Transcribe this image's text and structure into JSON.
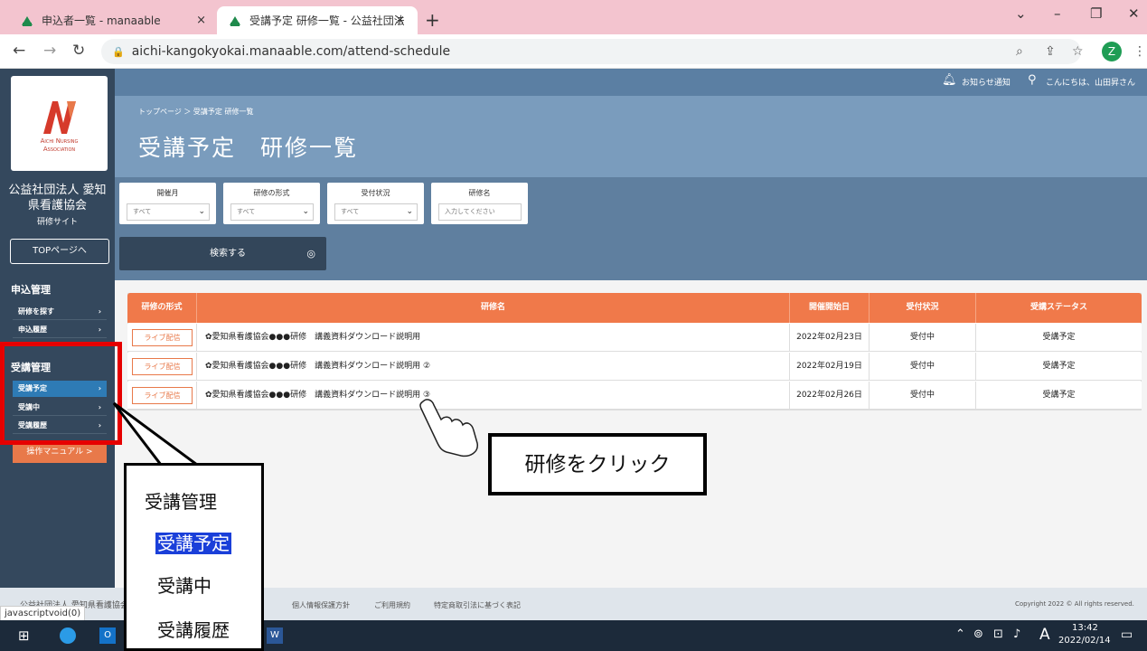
{
  "browser": {
    "tabs": [
      {
        "title": "申込者一覧 - manaable",
        "close": "×"
      },
      {
        "title": "受講予定 研修一覧 - 公益社団法",
        "close": "×"
      }
    ],
    "new_tab": "+",
    "url": "aichi-kangokyokai.manaable.com/attend-schedule",
    "profile_letter": "Z",
    "status_url": "javascriptvoid(0)"
  },
  "header": {
    "notice": "お知らせ通知",
    "greeting": "こんにちは、山田昇さん",
    "breadcrumb": "トップページ ＞ 受講予定 研修一覧",
    "page_title": "受講予定　研修一覧"
  },
  "sidebar": {
    "logo_line1": "Aichi Nursing",
    "logo_line2": "Association",
    "site_name_1": "公益社団法人 愛知",
    "site_name_2": "県看護協会",
    "site_sub": "研修サイト",
    "top_button": "TOPページへ",
    "section1": "申込管理",
    "section1_items": [
      {
        "label": "研修を探す"
      },
      {
        "label": "申込履歴"
      }
    ],
    "section2": "受講管理",
    "section2_items": [
      {
        "label": "受講予定"
      },
      {
        "label": "受講中"
      },
      {
        "label": "受講履歴"
      }
    ],
    "manual": "操作マニュアル >"
  },
  "filters": [
    {
      "label": "開催月",
      "value": "すべて"
    },
    {
      "label": "研修の形式",
      "value": "すべて"
    },
    {
      "label": "受付状況",
      "value": "すべて"
    },
    {
      "label": "研修名",
      "placeholder": "入力してください"
    }
  ],
  "search_button": "検索する",
  "table": {
    "headers": [
      "研修の形式",
      "研修名",
      "開催開始日",
      "受付状況",
      "受講ステータス"
    ],
    "rows": [
      {
        "format": "ライブ配信",
        "name": "✿愛知県看護協会●●●研修　講義資料ダウンロード説明用",
        "date": "2022年02月23日",
        "reception": "受付中",
        "status": "受講予定"
      },
      {
        "format": "ライブ配信",
        "name": "✿愛知県看護協会●●●研修　講義資料ダウンロード説明用 ②",
        "date": "2022年02月19日",
        "reception": "受付中",
        "status": "受講予定"
      },
      {
        "format": "ライブ配信",
        "name": "✿愛知県看護協会●●●研修　講義資料ダウンロード説明用 ③",
        "date": "2022年02月26日",
        "reception": "受付中",
        "status": "受講予定"
      }
    ]
  },
  "footer": {
    "org": "公益社団法人 愛知県看護協会",
    "links": [
      "個人情報保護方針",
      "ご利用規約",
      "特定商取引法に基づく表記"
    ],
    "copyright": "Copyright 2022 © All rights reserved."
  },
  "callout": {
    "title": "受講管理",
    "item1": "受講予定",
    "item2": "受講中",
    "item3": "受講履歴"
  },
  "click_note": "研修をクリック",
  "taskbar": {
    "time": "13:42",
    "date": "2022/02/14",
    "ime": "A"
  },
  "colors": {
    "accent": "#f0794a",
    "sidebar": "#34485d",
    "header": "#7a9cbd",
    "highlight": "#e60000"
  }
}
